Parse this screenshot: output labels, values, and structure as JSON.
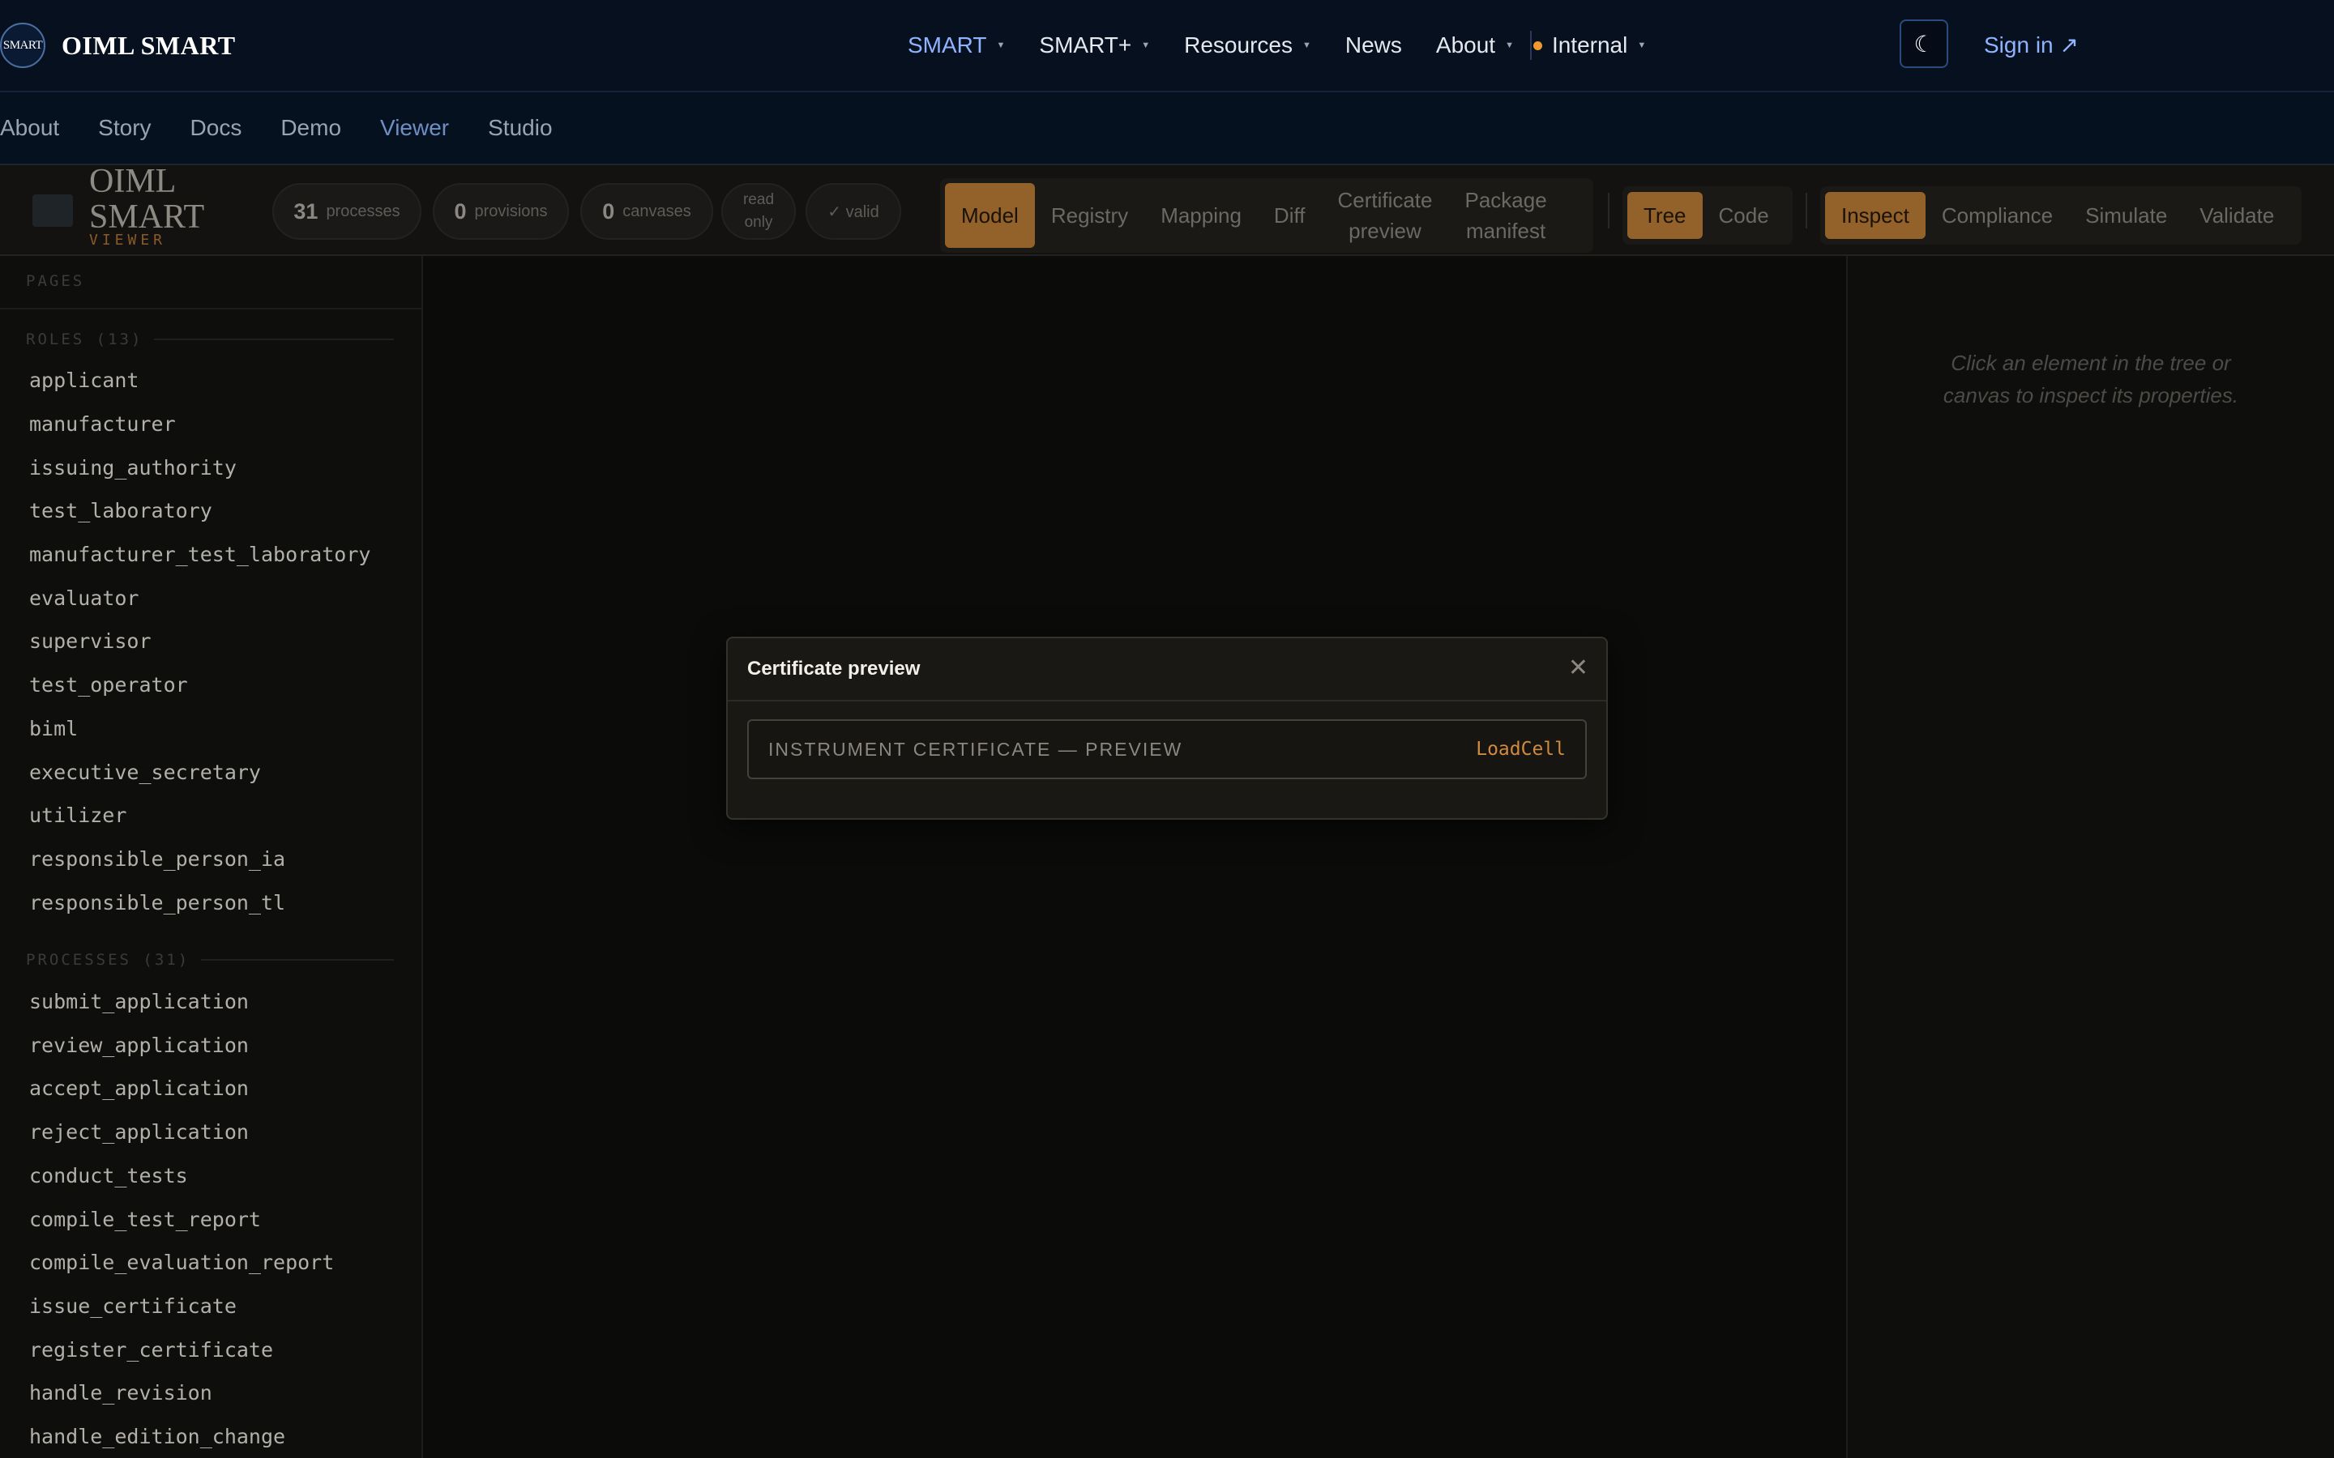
{
  "site": {
    "logo_text": "SMART",
    "name": "OIML SMART",
    "menu": [
      {
        "label": "SMART",
        "has_caret": true,
        "active": true
      },
      {
        "label": "SMART+",
        "has_caret": true
      },
      {
        "label": "Resources",
        "has_caret": true
      },
      {
        "label": "News",
        "has_caret": false
      },
      {
        "label": "About",
        "has_caret": true
      },
      {
        "label": "Internal",
        "has_caret": true,
        "status_dot_color": "#f0992e"
      }
    ],
    "theme_icon": "moon-icon",
    "signin_label": "Sign in ↗"
  },
  "subnav": {
    "items": [
      "About",
      "Story",
      "Docs",
      "Demo",
      "Viewer",
      "Studio"
    ],
    "active": "Viewer"
  },
  "viewer": {
    "brand_line1": "OIML",
    "brand_line2": "SMART",
    "brand_sub": "VIEWER",
    "stats": {
      "processes_count": "31",
      "processes_label": "processes",
      "provisions_count": "0",
      "provisions_label": "provisions",
      "canvases_count": "0",
      "canvases_label": "canvases",
      "readonly_label_1": "read",
      "readonly_label_2": "only",
      "valid_label": "✓ valid"
    },
    "view_tabs": [
      "Model",
      "Registry",
      "Mapping",
      "Diff",
      "Certificate preview",
      "Package manifest"
    ],
    "view_tab_lines": {
      "certificate_1": "Certificate",
      "certificate_2": "preview",
      "package_1": "Package",
      "package_2": "manifest"
    },
    "mode_tabs": [
      "Tree",
      "Code"
    ],
    "panel_tabs": [
      "Inspect",
      "Compliance",
      "Simulate",
      "Validate"
    ],
    "active": {
      "view": "Model",
      "mode": "Tree",
      "panel": "Inspect"
    }
  },
  "sidebar": {
    "pages_heading": "PAGES",
    "roles_heading": "ROLES (13)",
    "roles": [
      "applicant",
      "manufacturer",
      "issuing_authority",
      "test_laboratory",
      "manufacturer_test_laboratory",
      "evaluator",
      "supervisor",
      "test_operator",
      "biml",
      "executive_secretary",
      "utilizer",
      "responsible_person_ia",
      "responsible_person_tl"
    ],
    "processes_heading": "PROCESSES (31)",
    "processes": [
      "submit_application",
      "review_application",
      "accept_application",
      "reject_application",
      "conduct_tests",
      "compile_test_report",
      "compile_evaluation_report",
      "issue_certificate",
      "register_certificate",
      "handle_revision",
      "handle_edition_change"
    ]
  },
  "inspector": {
    "hint_line1": "Click an element in the tree or",
    "hint_line2": "canvas to inspect its properties."
  },
  "modal": {
    "title": "Certificate preview",
    "close_icon": "close-icon",
    "certificate_title": "INSTRUMENT CERTIFICATE — PREVIEW",
    "certificate_type": "LoadCell"
  },
  "colors": {
    "accent": "#93612a",
    "link": "#8fb4ff",
    "status_dot": "#f0992e"
  }
}
